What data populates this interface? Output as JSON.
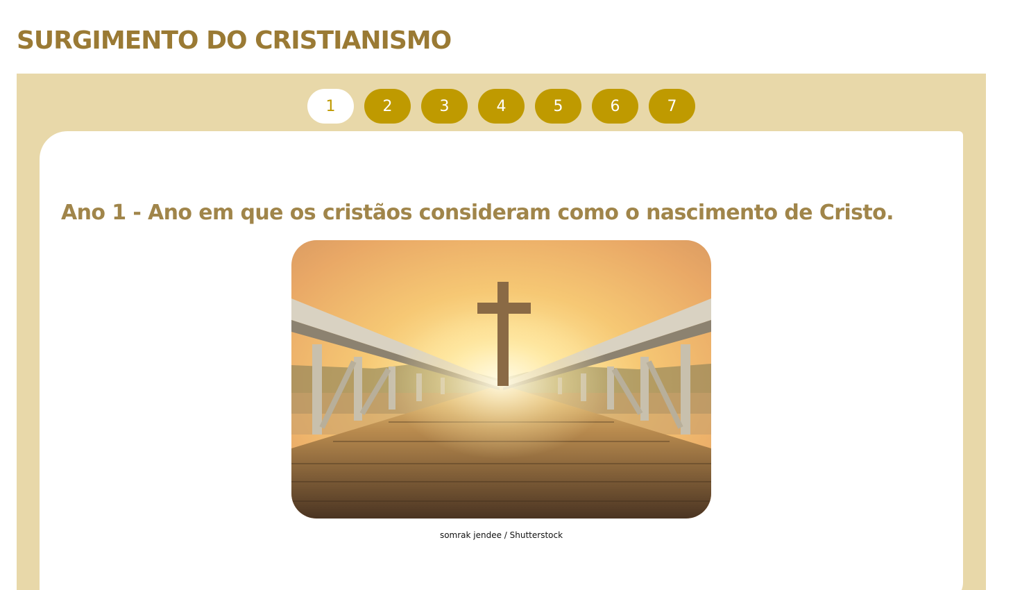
{
  "page": {
    "title": "SURGIMENTO DO CRISTIANISMO"
  },
  "tabs": [
    {
      "label": "1",
      "active": true
    },
    {
      "label": "2",
      "active": false
    },
    {
      "label": "3",
      "active": false
    },
    {
      "label": "4",
      "active": false
    },
    {
      "label": "5",
      "active": false
    },
    {
      "label": "6",
      "active": false
    },
    {
      "label": "7",
      "active": false
    }
  ],
  "slide": {
    "heading": "Ano 1 - Ano em que os cristãos consideram como o nascimento de Cristo.",
    "image_credit": "somrak jendee / Shutterstock"
  },
  "colors": {
    "title": "#9a7a34",
    "panel_bg": "#e8d8a9",
    "tab_bg": "#bf9a00",
    "heading": "#a0854a"
  }
}
